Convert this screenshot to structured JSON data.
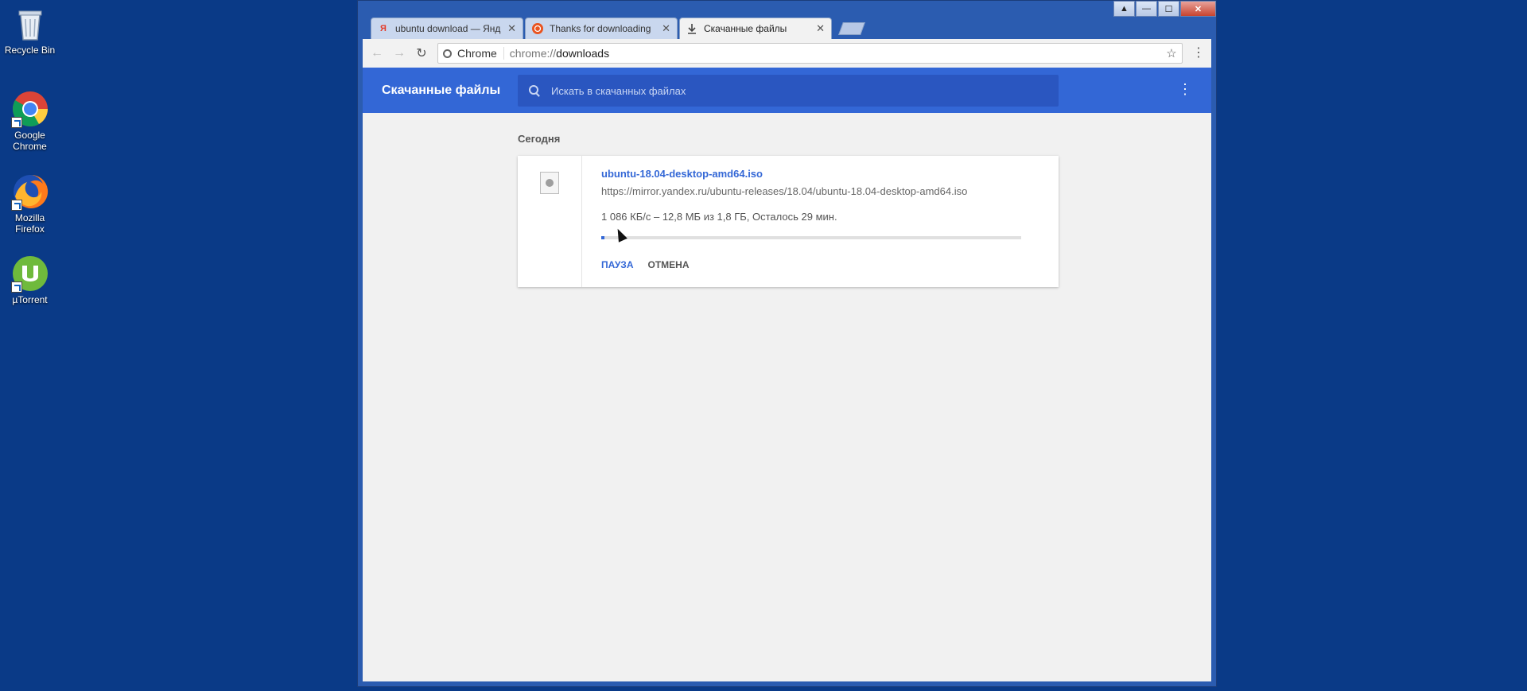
{
  "desktop": {
    "icons": [
      {
        "label": "Recycle Bin"
      },
      {
        "label": "Google\nChrome"
      },
      {
        "label": "Mozilla\nFirefox"
      },
      {
        "label": "µTorrent"
      }
    ]
  },
  "browser": {
    "tabs": [
      {
        "favicon": "yandex-icon",
        "title": "ubuntu download — Янд"
      },
      {
        "favicon": "ubuntu-icon",
        "title": "Thanks for downloading"
      },
      {
        "favicon": "download-icon",
        "title": "Скачанные файлы"
      }
    ],
    "active_tab": 2,
    "omnibox": {
      "site_label": "Chrome",
      "url_scheme": "chrome://",
      "url_path": "downloads"
    }
  },
  "page": {
    "title": "Скачанные файлы",
    "search_placeholder": "Искать в скачанных файлах",
    "section": "Сегодня",
    "download": {
      "file_name": "ubuntu-18.04-desktop-amd64.iso",
      "url": "https://mirror.yandex.ru/ubuntu-releases/18.04/ubuntu-18.04-desktop-amd64.iso",
      "status": "1 086 КБ/с – 12,8 МБ из 1,8 ГБ, Осталось 29 мин.",
      "progress_fraction": 0.007,
      "pause_label": "ПАУЗА",
      "cancel_label": "ОТМЕНА"
    }
  },
  "colors": {
    "desktop_bg": "#0a3a87",
    "accent": "#3367d6"
  }
}
